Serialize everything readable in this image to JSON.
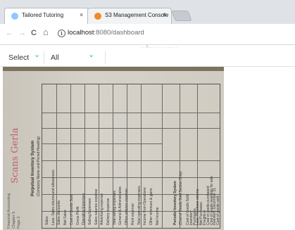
{
  "browser": {
    "tabs": [
      {
        "title": "Tailored Tutoring",
        "close": "×",
        "favicon_color": "#8fc8ff"
      },
      {
        "title": "S3 Management Console",
        "close": "×",
        "favicon_color": "#f08a24"
      }
    ],
    "nav": {
      "back": "←",
      "forward": "→",
      "reload": "C",
      "home": "⌂"
    },
    "address": {
      "info": "i",
      "host": "localhost",
      "path": ":8080/dashboard"
    }
  },
  "banner_partial_text": "...s... ..... .... ..",
  "filters": [
    {
      "label": "Select",
      "chevron": "⌄"
    },
    {
      "label": "All",
      "chevron": "⌄"
    }
  ],
  "document": {
    "signature": "Scans Gerla",
    "side_note": [
      "Financial Accounting",
      "Chapter 5",
      "Page 2"
    ],
    "header_lines": [
      "Perpetual Inventory System",
      "(Company Name and Period Heading)",
      "Fill in below"
    ],
    "row_labels": [
      "Sales",
      "Less: Sales returns and allowances",
      "Sales discounts",
      "Net Sales",
      "Cost of Goods Sold",
      "Gross Profit",
      "Operating Expenses",
      "Selling Expenses",
      "Sales salaries expense",
      "Advertising expense",
      "Delivery expense",
      "Total selling expenses",
      "General & Administrative",
      "Office salaries expense",
      "Rent expense",
      "Total operating expenses",
      "Income from Operations",
      "Other revenues & gains",
      "Net Income"
    ],
    "lower_header": [
      "Periodic Inventory System",
      "(Cost of Goods Sold Section Only)"
    ],
    "lower_rows": [
      "Cost of Goods Sold",
      "Inventory",
      "Purchases",
      "Less: Purchase returns",
      "Net Purchases",
      "Freight-in",
      "Cost of goods purchased",
      "Cost of goods available for sale",
      "Inventory, December 31",
      "Cost of goods sold"
    ]
  }
}
